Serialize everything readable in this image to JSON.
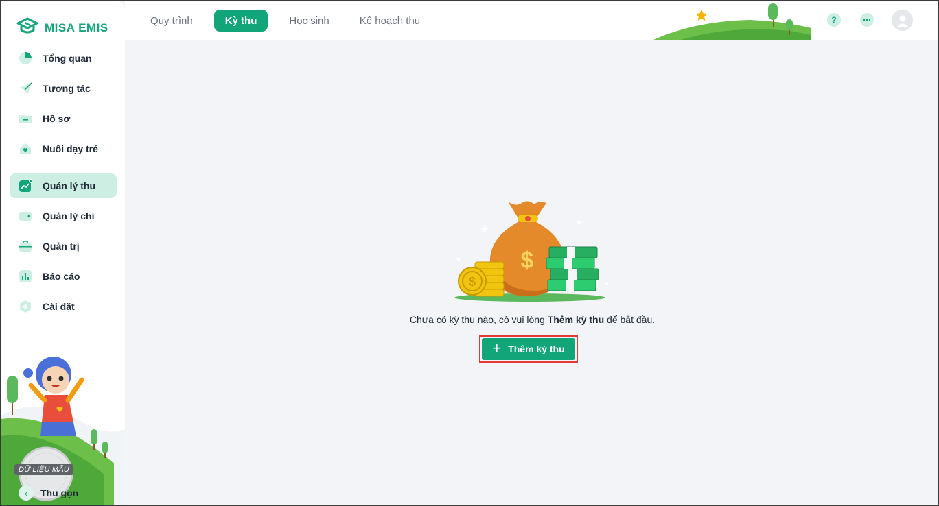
{
  "brand": {
    "name": "MISA EMIS",
    "color": "#14a57a"
  },
  "sidebar": {
    "items": [
      {
        "label": "Tổng quan",
        "icon": "pie-chart-icon"
      },
      {
        "label": "Tương tác",
        "icon": "paper-plane-icon"
      },
      {
        "label": "Hồ sơ",
        "icon": "folder-icon"
      },
      {
        "label": "Nuôi dạy trẻ",
        "icon": "heart-house-icon"
      },
      {
        "label": "Quản lý thu",
        "icon": "trend-chart-icon",
        "active": true
      },
      {
        "label": "Quản lý chi",
        "icon": "wallet-icon"
      },
      {
        "label": "Quản trị",
        "icon": "briefcase-icon"
      },
      {
        "label": "Báo cáo",
        "icon": "bar-chart-icon"
      },
      {
        "label": "Cài đặt",
        "icon": "gear-icon"
      }
    ],
    "collapse_label": "Thu gọn",
    "stamp_label": "DỮ LIỆU MẪU"
  },
  "topbar": {
    "tabs": [
      {
        "label": "Quy trình"
      },
      {
        "label": "Kỳ thu",
        "active": true
      },
      {
        "label": "Học sinh"
      },
      {
        "label": "Kế hoạch thu"
      }
    ],
    "help_icon": "question-icon",
    "more_icon": "more-dots-icon",
    "avatar_icon": "user-avatar-icon"
  },
  "empty_state": {
    "message_before": "Chưa có kỳ thu nào, cô vui lòng ",
    "message_bold": "Thêm kỳ thu",
    "message_after": " để bắt đầu.",
    "button_label": "Thêm kỳ thu",
    "illustration_icon": "money-bag-icon"
  }
}
